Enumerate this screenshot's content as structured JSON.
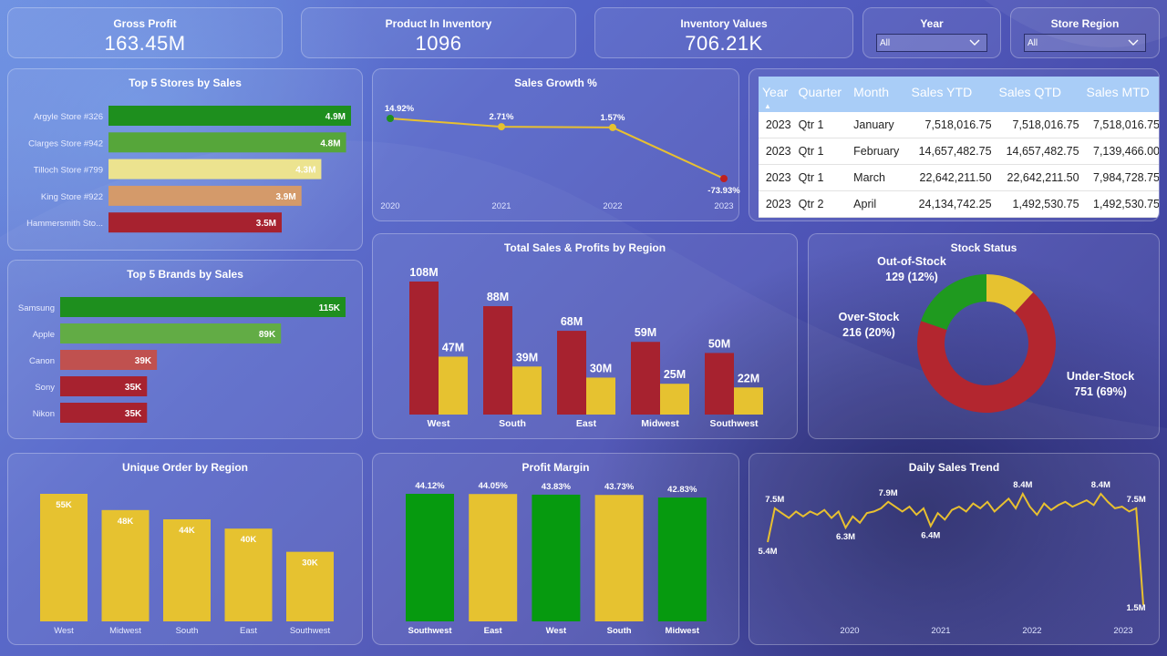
{
  "kpis": [
    {
      "label": "Gross Profit",
      "value": "163.45M"
    },
    {
      "label": "Product In Inventory",
      "value": "1096"
    },
    {
      "label": "Inventory Values",
      "value": "706.21K"
    }
  ],
  "slicers": [
    {
      "label": "Year",
      "value": "All"
    },
    {
      "label": "Store Region",
      "value": "All"
    }
  ],
  "table": {
    "headers": [
      "Year",
      "Quarter",
      "Month",
      "Sales YTD",
      "Sales QTD",
      "Sales MTD"
    ],
    "rows": [
      [
        "2023",
        "Qtr 1",
        "January",
        "7,518,016.75",
        "7,518,016.75",
        "7,518,016.75"
      ],
      [
        "2023",
        "Qtr 1",
        "February",
        "14,657,482.75",
        "14,657,482.75",
        "7,139,466.00"
      ],
      [
        "2023",
        "Qtr 1",
        "March",
        "22,642,211.50",
        "22,642,211.50",
        "7,984,728.75"
      ],
      [
        "2023",
        "Qtr 2",
        "April",
        "24,134,742.25",
        "1,492,530.75",
        "1,492,530.75"
      ]
    ]
  },
  "colors": {
    "green": "#1e8f1e",
    "lightgreen": "#5aa83c",
    "yellowpale": "#ece38f",
    "tan": "#d49a6a",
    "red": "#a7222f",
    "salmon": "#c0514f",
    "yellow": "#e6c230",
    "darkgreen": "#069a0f",
    "line": "#e8c030"
  },
  "chart_data": [
    {
      "id": "stores",
      "type": "bar",
      "orientation": "horizontal",
      "title": "Top 5 Stores by Sales",
      "categories": [
        "Argyle Store #326",
        "Clarges Store #942",
        "Tilloch Store #799",
        "King Store #922",
        "Hammersmith Sto..."
      ],
      "values": [
        4.9,
        4.8,
        4.3,
        3.9,
        3.5
      ],
      "labels": [
        "4.9M",
        "4.8M",
        "4.3M",
        "3.9M",
        "3.5M"
      ],
      "bar_colors": [
        "#1e8f1e",
        "#56a63a",
        "#ece38f",
        "#d49a6a",
        "#a7222f"
      ]
    },
    {
      "id": "brands",
      "type": "bar",
      "orientation": "horizontal",
      "title": "Top 5 Brands by Sales",
      "categories": [
        "Samsung",
        "Apple",
        "Canon",
        "Sony",
        "Nikon"
      ],
      "values": [
        115,
        89,
        39,
        35,
        35
      ],
      "labels": [
        "115K",
        "89K",
        "39K",
        "35K",
        "35K"
      ],
      "bar_colors": [
        "#1e8f1e",
        "#62ac45",
        "#c0514f",
        "#a7222f",
        "#a7222f"
      ]
    },
    {
      "id": "growth",
      "type": "line",
      "title": "Sales Growth %",
      "x": [
        "2020",
        "2021",
        "2022",
        "2023"
      ],
      "values": [
        14.92,
        2.71,
        1.57,
        -73.93
      ],
      "labels": [
        "14.92%",
        "2.71%",
        "1.57%",
        "-73.93%"
      ],
      "point_colors": [
        "#1e8f1e",
        "#e6c230",
        "#e6c230",
        "#c02020"
      ]
    },
    {
      "id": "region",
      "type": "bar",
      "title": "Total Sales & Profits by Region",
      "categories": [
        "West",
        "South",
        "East",
        "Midwest",
        "Southwest"
      ],
      "series": [
        {
          "values": [
            108,
            88,
            68,
            59,
            50
          ],
          "labels": [
            "108M",
            "88M",
            "68M",
            "59M",
            "50M"
          ],
          "color": "#a7222f"
        },
        {
          "values": [
            47,
            39,
            30,
            25,
            22
          ],
          "labels": [
            "47M",
            "39M",
            "30M",
            "25M",
            "22M"
          ],
          "color": "#e6c230"
        }
      ]
    },
    {
      "id": "stock",
      "type": "pie",
      "title": "Stock Status",
      "categories": [
        "Under-Stock",
        "Over-Stock",
        "Out-of-Stock"
      ],
      "values": [
        751,
        216,
        129
      ],
      "labels": [
        "751 (69%)",
        "216 (20%)",
        "129 (12%)"
      ],
      "slice_colors": [
        "#b3262f",
        "#1f9a1f",
        "#e6c230"
      ]
    },
    {
      "id": "orders",
      "type": "bar",
      "title": "Unique Order by Region",
      "categories": [
        "West",
        "Midwest",
        "South",
        "East",
        "Southwest"
      ],
      "values": [
        55,
        48,
        44,
        40,
        30
      ],
      "labels": [
        "55K",
        "48K",
        "44K",
        "40K",
        "30K"
      ],
      "color": "#e6c230"
    },
    {
      "id": "margin",
      "type": "bar",
      "title": "Profit Margin",
      "categories": [
        "Southwest",
        "East",
        "West",
        "South",
        "Midwest"
      ],
      "values": [
        44.12,
        44.05,
        43.83,
        43.73,
        42.83
      ],
      "labels": [
        "44.12%",
        "44.05%",
        "43.83%",
        "43.73%",
        "42.83%"
      ],
      "bar_colors": [
        "#069a0f",
        "#e6c230",
        "#069a0f",
        "#e6c230",
        "#069a0f"
      ],
      "ylim": [
        0,
        50
      ]
    },
    {
      "id": "daily",
      "type": "line",
      "title": "Daily Sales Trend",
      "x_ticks": [
        "2020",
        "2021",
        "2022",
        "2023"
      ],
      "values": [
        5.4,
        7.5,
        7.2,
        6.9,
        7.3,
        7.0,
        7.3,
        7.1,
        7.4,
        6.9,
        7.3,
        6.3,
        7.0,
        6.6,
        7.2,
        7.3,
        7.5,
        7.9,
        7.6,
        7.3,
        7.6,
        7.1,
        7.5,
        6.4,
        7.2,
        6.8,
        7.4,
        7.6,
        7.3,
        7.8,
        7.5,
        7.9,
        7.3,
        7.7,
        8.1,
        7.5,
        8.4,
        7.6,
        7.1,
        7.8,
        7.4,
        7.7,
        7.9,
        7.6,
        7.8,
        8.0,
        7.7,
        8.4,
        7.9,
        7.5,
        7.6,
        7.3,
        7.5,
        1.5
      ],
      "point_labels": [
        {
          "i": 0,
          "label": "5.4M"
        },
        {
          "i": 1,
          "label": "7.5M"
        },
        {
          "i": 11,
          "label": "6.3M"
        },
        {
          "i": 17,
          "label": "7.9M"
        },
        {
          "i": 23,
          "label": "6.4M"
        },
        {
          "i": 36,
          "label": "8.4M"
        },
        {
          "i": 47,
          "label": "8.4M"
        },
        {
          "i": 52,
          "label": "7.5M"
        },
        {
          "i": 53,
          "label": "1.5M"
        }
      ]
    }
  ]
}
